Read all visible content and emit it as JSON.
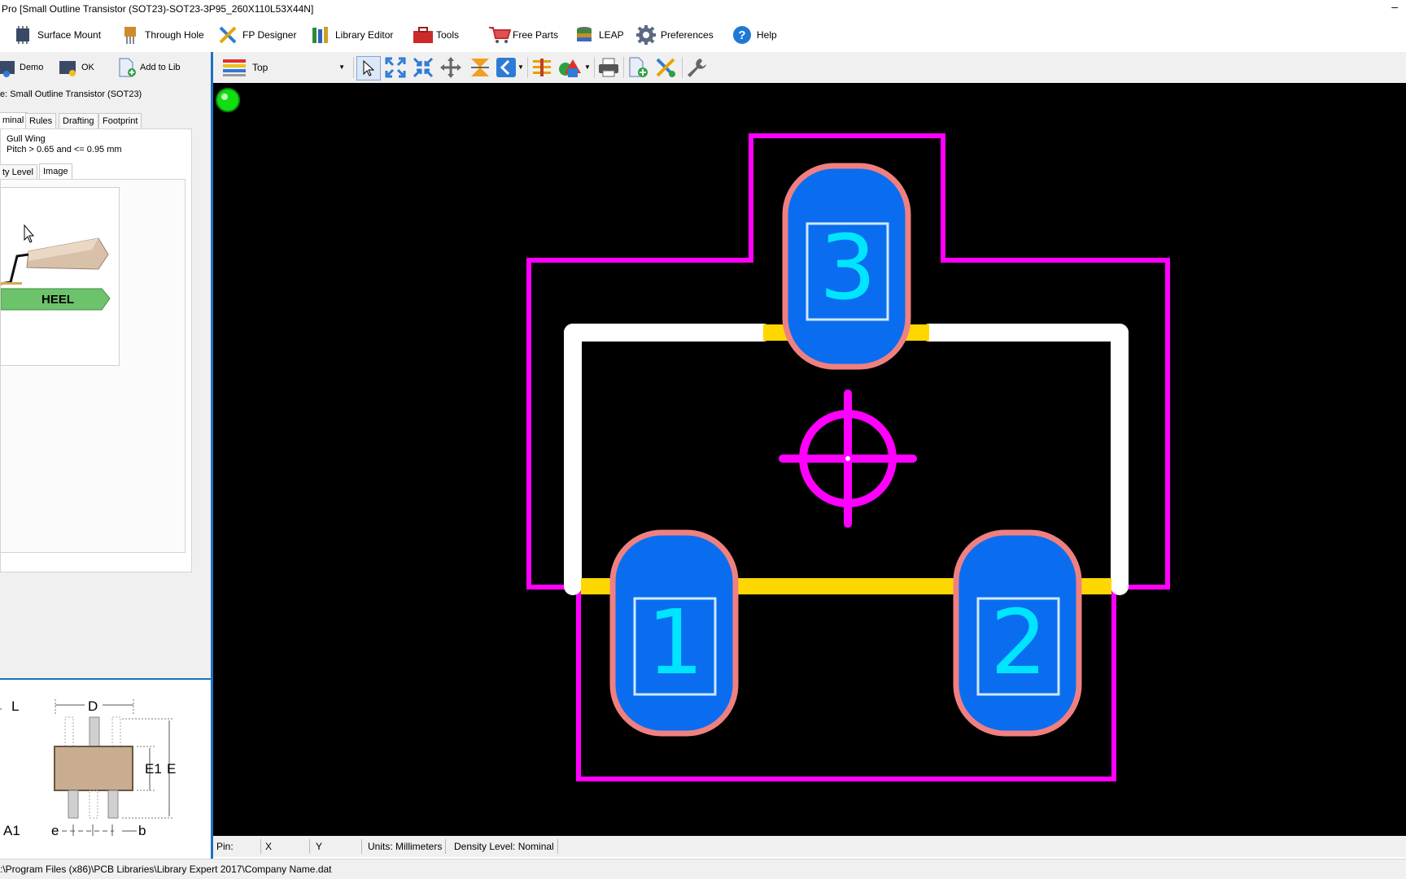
{
  "window": {
    "title": "Pro [Small Outline Transistor (SOT23)-SOT23-3P95_260X110L53X44N]",
    "minimize_glyph": "–"
  },
  "menubar": {
    "items": [
      {
        "label": "Surface Mount",
        "icon": "surface-mount-chip-icon"
      },
      {
        "label": "Through Hole",
        "icon": "through-hole-icon"
      },
      {
        "label": "FP Designer",
        "icon": "fp-designer-tools-icon"
      },
      {
        "label": "Library Editor",
        "icon": "library-books-icon"
      },
      {
        "label": "Tools",
        "icon": "toolbox-icon"
      },
      {
        "label": "Free Parts",
        "icon": "shopping-cart-icon"
      },
      {
        "label": "LEAP",
        "icon": "database-stack-icon"
      },
      {
        "label": "Preferences",
        "icon": "gear-icon"
      },
      {
        "label": "Help",
        "icon": "help-icon"
      }
    ]
  },
  "left": {
    "buttons": {
      "demo": "Demo",
      "ok": "OK",
      "add_to_lib": "Add to Lib"
    },
    "family_label": "e: Small Outline Transistor (SOT23)",
    "tabs": [
      "minal",
      "Rules",
      "Drafting",
      "Footprint"
    ],
    "lead_type": "Gull Wing",
    "pitch": "Pitch > 0.65 and <= 0.95 mm",
    "subtabs": [
      "ty Level",
      "Image"
    ],
    "image_label": "HEEL",
    "drawing_labels": {
      "L": "L",
      "D": "D",
      "E1": "E1",
      "E": "E",
      "A1": "A1",
      "e": "e",
      "b": "b"
    }
  },
  "toolbar2": {
    "layer_select": "Top",
    "tools": [
      "select-arrow-icon",
      "zoom-extents-icon",
      "zoom-fit-icon",
      "pan-icon",
      "flip-icon",
      "back-arrow-icon",
      "layers-icon",
      "shapes-icon",
      "print-icon",
      "new-file-icon",
      "design-tools-icon",
      "wrench-icon"
    ]
  },
  "canvas": {
    "pads": [
      {
        "number": "3"
      },
      {
        "number": "1"
      },
      {
        "number": "2"
      }
    ],
    "colors": {
      "background": "#000000",
      "courtyard": "#ff00ff",
      "silkscreen": "#ffffff",
      "assembly": "#ffd700",
      "pad": "#0a6df0",
      "pad_outline": "#f08080",
      "pad_number": "#00e5ff",
      "status_led": "#11dd11"
    }
  },
  "status": {
    "pin": "Pin:",
    "x": "X",
    "y": "Y",
    "units": "Units: Millimeters",
    "density": "Density Level: Nominal"
  },
  "path": ":\\Program Files (x86)\\PCB Libraries\\Library Expert 2017\\Company Name.dat"
}
